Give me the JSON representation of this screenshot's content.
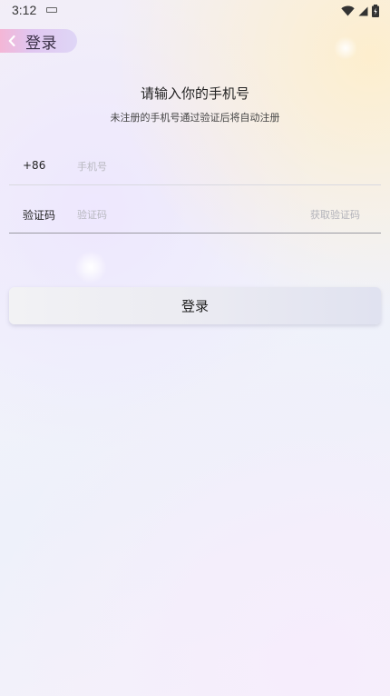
{
  "status_bar": {
    "time": "3:12",
    "icons": [
      "keyboard-icon",
      "wifi-icon",
      "signal-icon",
      "battery-icon"
    ]
  },
  "header": {
    "back_label": "登录"
  },
  "form": {
    "title": "请输入你的手机号",
    "subtitle": "未注册的手机号通过验证后将自动注册",
    "phone": {
      "prefix": "+86",
      "value": "",
      "placeholder": "手机号"
    },
    "code": {
      "label": "验证码",
      "value": "",
      "placeholder": "验证码",
      "get_code_label": "获取验证码"
    },
    "login_label": "登录"
  },
  "colors": {
    "back_pill_start": "#f4b6d6",
    "back_pill_end": "#dfd6f6",
    "placeholder": "#b8b8bf",
    "get_code_text": "#b3b3ba"
  }
}
